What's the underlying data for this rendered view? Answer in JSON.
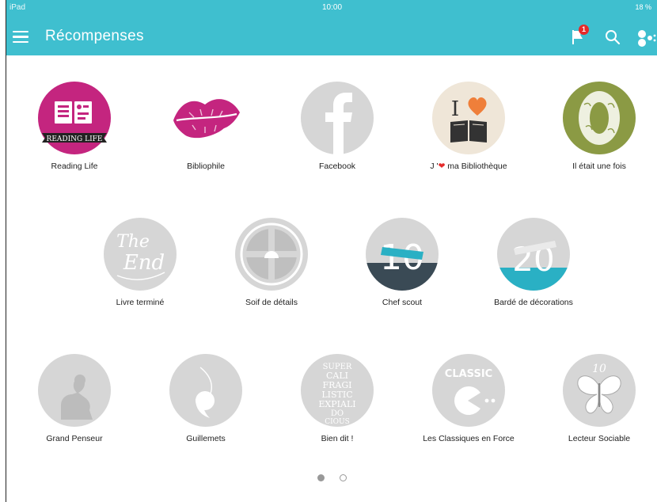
{
  "status": {
    "left": "iPad",
    "time": "10:00",
    "right": "18 %"
  },
  "nav": {
    "title": "Récompenses",
    "notification_count": "1"
  },
  "badges": {
    "reading_life": {
      "label": "Reading Life",
      "banner": "READING LIFE"
    },
    "bibliophile": {
      "label": "Bibliophile"
    },
    "facebook": {
      "label": "Facebook"
    },
    "bibliotheque": {
      "label_prefix": "J '",
      "label_suffix": " ma Bibliothèque"
    },
    "il_etait": {
      "label": "Il était une fois"
    },
    "livre_termine": {
      "label": "Livre terminé",
      "art_line1": "The",
      "art_line2": "End"
    },
    "soif": {
      "label": "Soif de détails"
    },
    "chef_scout": {
      "label": "Chef scout",
      "art": "10"
    },
    "barde": {
      "label": "Bardé de décorations",
      "art": "20"
    },
    "grand_penseur": {
      "label": "Grand Penseur"
    },
    "guillemets": {
      "label": "Guillemets"
    },
    "bien_dit": {
      "label": "Bien dit !",
      "art": [
        "SUPER",
        "CALI",
        "FRAGI",
        "LISTIC",
        "EXPIALI",
        "DO",
        "CIOUS"
      ]
    },
    "classiques": {
      "label": "Les Classiques en Force",
      "art": "CLASSIC"
    },
    "lecteur_sociable": {
      "label": "Lecteur Sociable",
      "art": "10"
    }
  },
  "colors": {
    "accent": "#3fbfcf",
    "magenta": "#c4257f",
    "olive": "#8b9a44",
    "orange": "#ef7f3a",
    "teal": "#2ab0c4",
    "slate": "#3a4a55"
  },
  "pager": {
    "pages": 2,
    "current": 1
  }
}
